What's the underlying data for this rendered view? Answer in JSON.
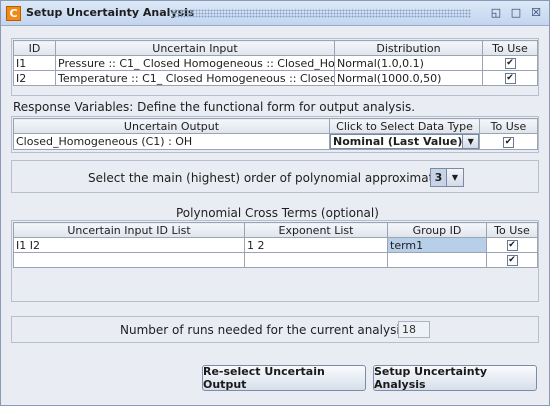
{
  "window": {
    "title": "Setup Uncertainty Analysis",
    "icon_glyph": "C",
    "controls": [
      "restore-icon",
      "maximize-icon",
      "close-icon"
    ]
  },
  "inputs_table": {
    "headers": [
      "ID",
      "Uncertain Input",
      "Distribution",
      "To Use"
    ],
    "rows": [
      {
        "id": "I1",
        "input": "Pressure :: C1_ Closed Homogeneous :: Closed_Hom...",
        "distribution": "Normal(1.0,0.1)",
        "to_use": true
      },
      {
        "id": "I2",
        "input": "Temperature :: C1_ Closed Homogeneous :: Closed_...",
        "distribution": "Normal(1000.0,50)",
        "to_use": true
      }
    ]
  },
  "response": {
    "label": "Response Variables: Define the functional form for output analysis.",
    "headers": [
      "Uncertain Output",
      "Click to Select Data Type",
      "To Use"
    ],
    "rows": [
      {
        "output": "Closed_Homogeneous (C1) : OH",
        "data_type": "Nominal (Last Value)",
        "to_use": true
      }
    ]
  },
  "order": {
    "label": "Select the main (highest) order of polynomial approximation:",
    "value": "3"
  },
  "cross_terms": {
    "title": "Polynomial Cross Terms (optional)",
    "headers": [
      "Uncertain Input ID List",
      "Exponent List",
      "Group ID",
      "To Use"
    ],
    "rows": [
      {
        "ids": "I1 I2",
        "exponents": "1 2",
        "group": "term1",
        "to_use": true
      },
      {
        "ids": "",
        "exponents": "",
        "group": "",
        "to_use": true
      }
    ]
  },
  "runs": {
    "label": "Number of runs needed for the current analysis:",
    "value": "18"
  },
  "buttons": {
    "reselect": "Re-select Uncertain Output",
    "setup": "Setup Uncertainty Analysis"
  },
  "checkmark": "✔",
  "colors": {
    "background": "#e9edf3",
    "selected_cell": "#b8cfe9",
    "title_gradient_top": "#dce8f7"
  }
}
